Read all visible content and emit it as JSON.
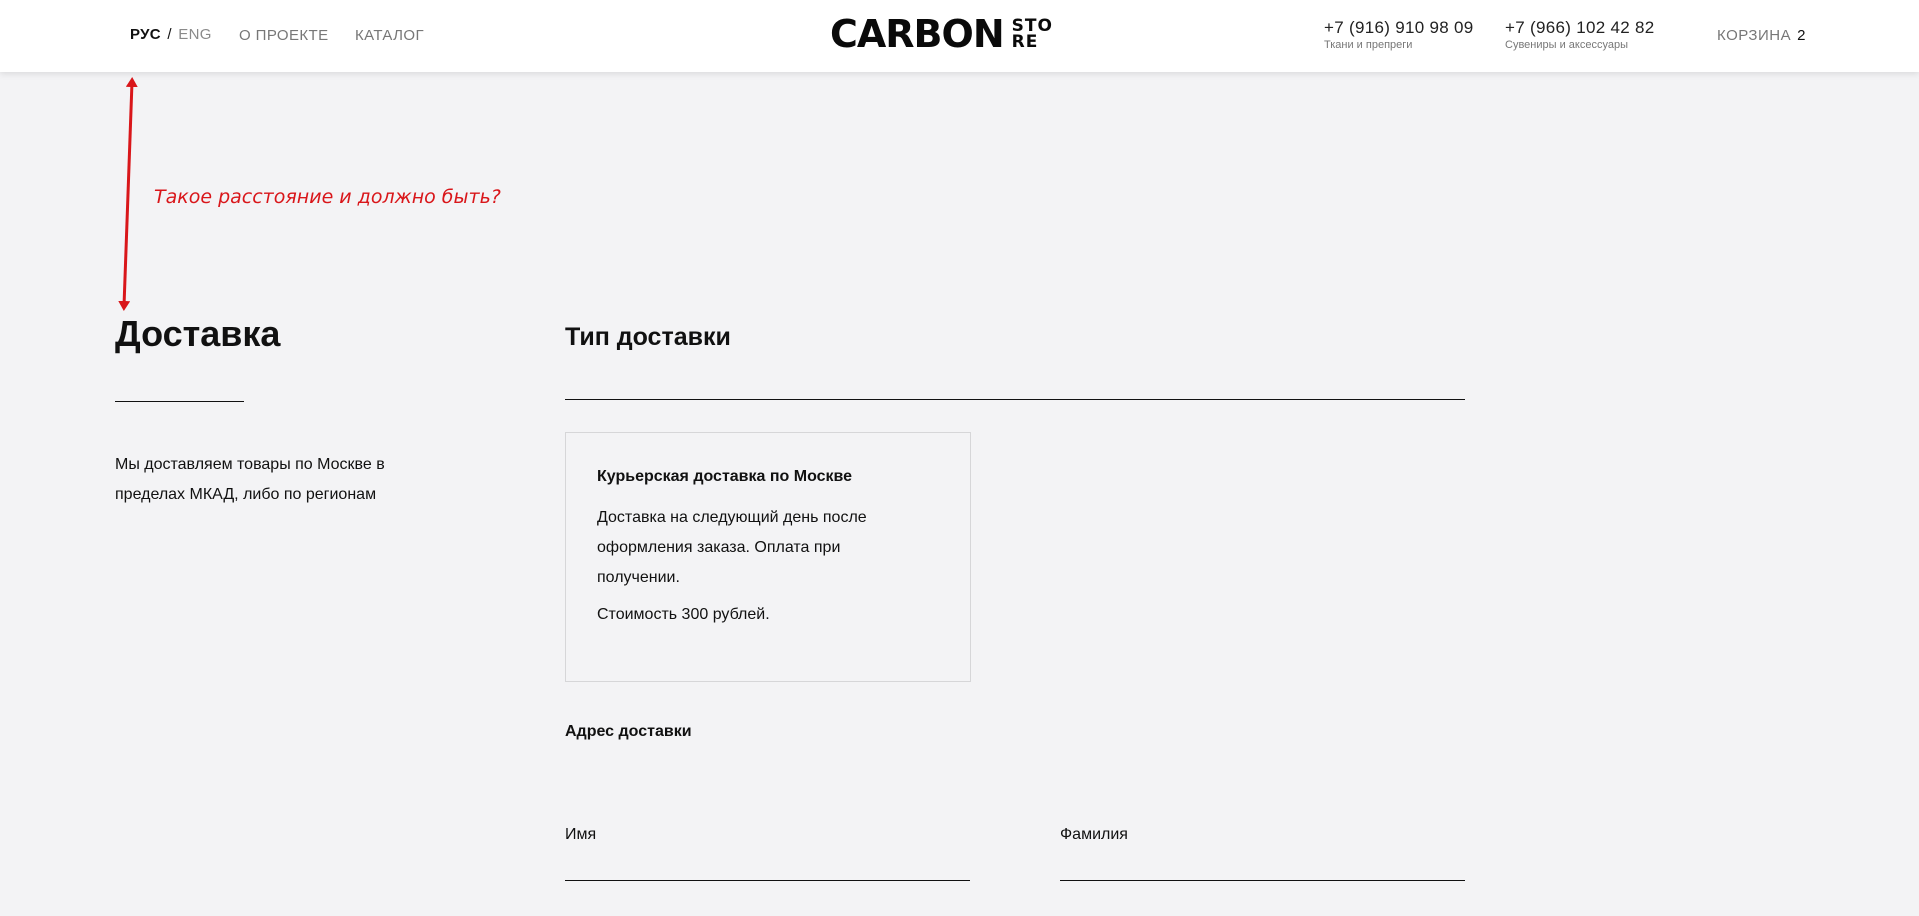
{
  "header": {
    "lang_active": "РУС",
    "lang_separator": "/",
    "lang_inactive": "ENG",
    "nav": {
      "about": "О ПРОЕКТЕ",
      "catalog": "КАТАЛОГ"
    },
    "logo": {
      "main": "CARBON",
      "sub_line1": "STO",
      "sub_line2": "RE"
    },
    "phones": [
      {
        "number": "+7 (916) 910 98 09",
        "desc": "Ткани и препреги"
      },
      {
        "number": "+7 (966) 102 42 82",
        "desc": "Сувениры и аксессуары"
      }
    ],
    "cart": {
      "label": "КОРЗИНА",
      "count": "2"
    }
  },
  "annotation": {
    "text": "Такое расстояние и должно быть?",
    "color": "#d9161a"
  },
  "page": {
    "title": "Доставка",
    "description": "Мы доставляем товары по Москве в пределах МКАД, либо по регионам"
  },
  "delivery": {
    "section_title": "Тип доставки",
    "option": {
      "title": "Курьерская доставка по Москве",
      "description": "Доставка на следующий день после оформления заказа. Оплата при получении.",
      "price": "Стоимость 300 рублей."
    },
    "address_title": "Адрес доставки",
    "fields": {
      "first_name_label": "Имя",
      "last_name_label": "Фамилия"
    }
  }
}
